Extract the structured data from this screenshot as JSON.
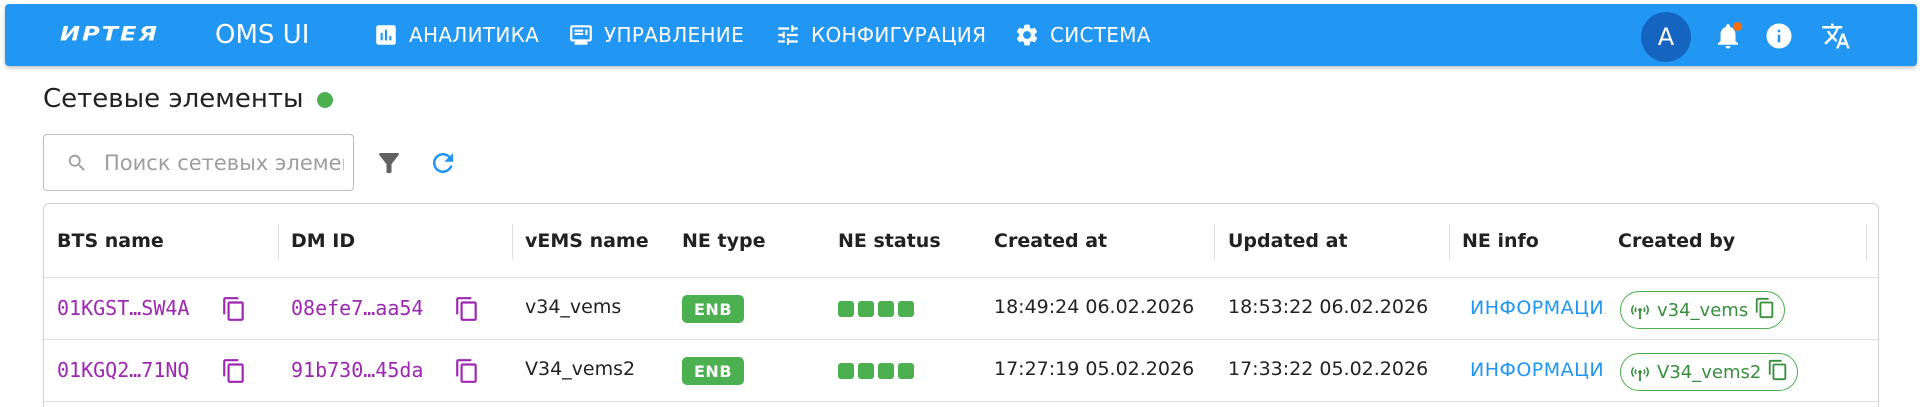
{
  "header": {
    "logo": "ИРТЕЯ",
    "app_name": "OMS UI",
    "nav": [
      {
        "label": "АНАЛИТИКА",
        "icon": "chart-icon"
      },
      {
        "label": "УПРАВЛЕНИЕ",
        "icon": "dashboard-icon"
      },
      {
        "label": "КОНФИГУРАЦИЯ",
        "icon": "tune-icon"
      },
      {
        "label": "СИСТЕМА",
        "icon": "gear-icon"
      }
    ],
    "avatar_letter": "A",
    "colors": {
      "bar": "#2196f3",
      "avatar": "#1565c0",
      "notification_dot": "#ff6d00"
    }
  },
  "page": {
    "title": "Сетевые элементы",
    "status_color": "#4caf50"
  },
  "search": {
    "placeholder": "Поиск сетевых элементов"
  },
  "table": {
    "columns": [
      "BTS name",
      "DM ID",
      "vEMS name",
      "NE type",
      "NE status",
      "Created at",
      "Updated at",
      "NE info",
      "Created by"
    ],
    "rows": [
      {
        "bts_name": "01KGST…SW4A",
        "dm_id": "08efe7…aa54",
        "vems_name": "v34_vems",
        "ne_type": "ENB",
        "ne_status": "online",
        "created_at": "18:49:24 06.02.2026",
        "updated_at": "18:53:22 06.02.2026",
        "ne_info": "ИНФОРМАЦИЯ",
        "created_by": "v34_vems"
      },
      {
        "bts_name": "01KGQ2…71NQ",
        "dm_id": "91b730…45da",
        "vems_name": "V34_vems2",
        "ne_type": "ENB",
        "ne_status": "online",
        "created_at": "17:27:19 05.02.2026",
        "updated_at": "17:33:22 05.02.2026",
        "ne_info": "ИНФОРМАЦИЯ",
        "created_by": "V34_vems2"
      }
    ]
  }
}
